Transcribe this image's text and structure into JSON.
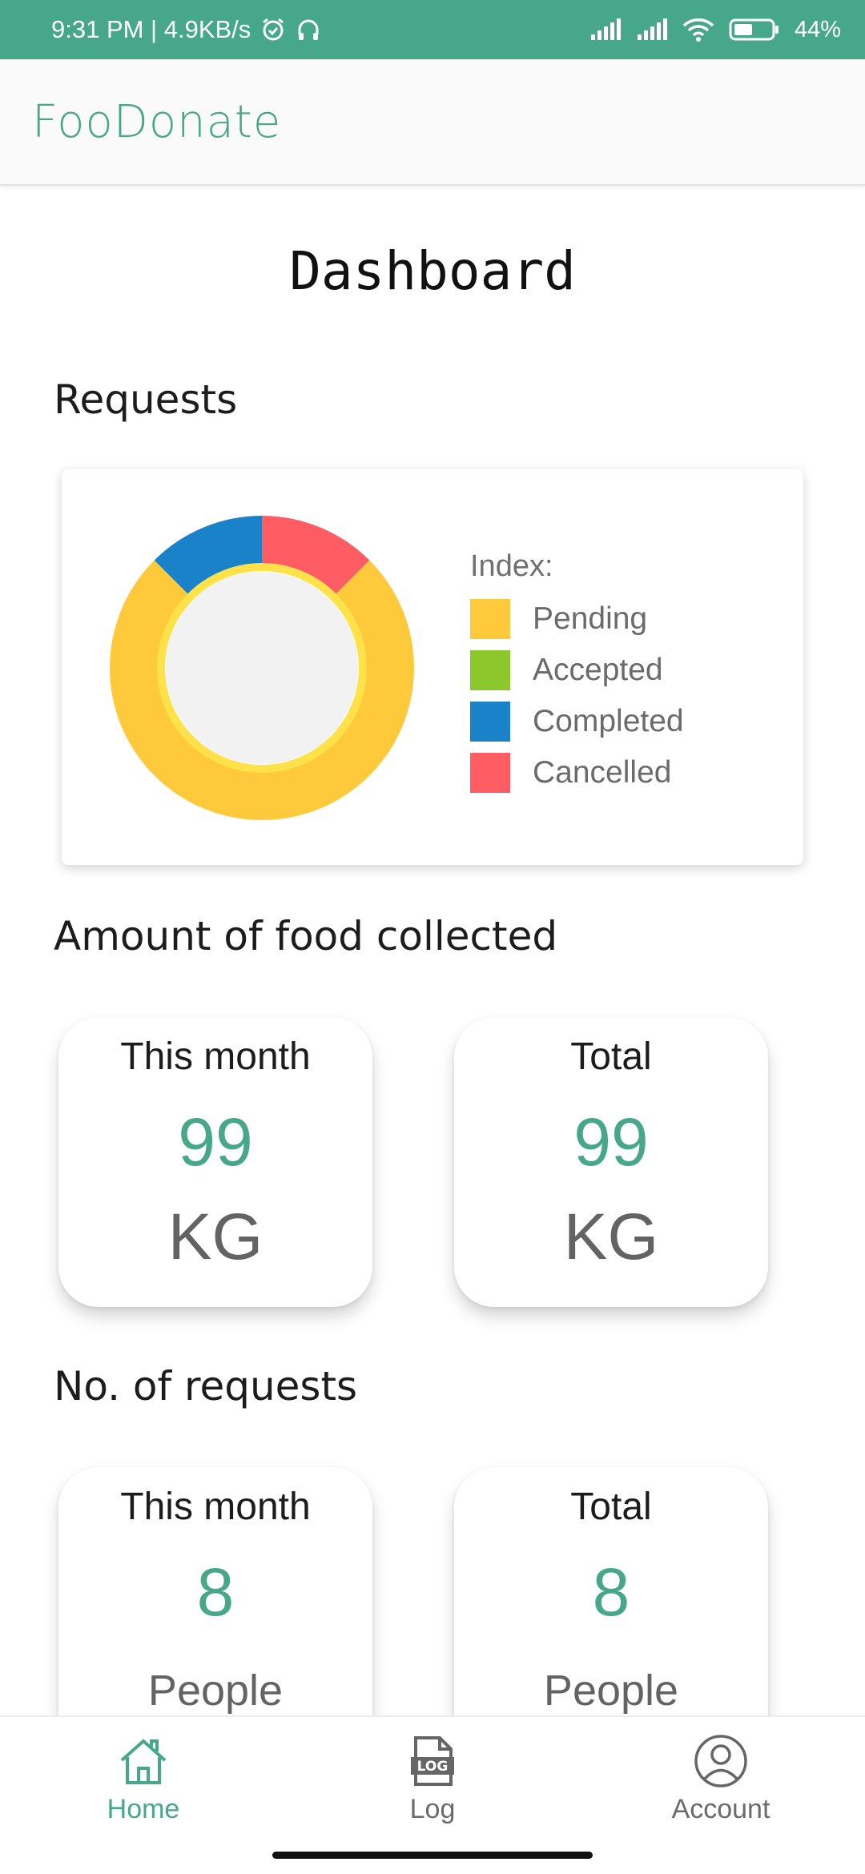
{
  "status_bar": {
    "time_speed": "9:31 PM | 4.9KB/s",
    "battery": "44%",
    "icons": [
      "alarm-icon",
      "headset-icon",
      "signal-icon",
      "signal-icon",
      "wifi-icon",
      "battery-icon"
    ]
  },
  "app_bar": {
    "title": "FooDonate"
  },
  "page": {
    "title": "Dashboard"
  },
  "sections": {
    "requests": "Requests",
    "food": "Amount of food collected",
    "num_requests": "No. of requests"
  },
  "chart_data": {
    "type": "pie",
    "donut": true,
    "legend_title": "Index:",
    "legend_position": "right",
    "series": [
      {
        "name": "Pending",
        "value": 0.75,
        "color": "#FFC93C"
      },
      {
        "name": "Accepted",
        "value": 0.0,
        "color": "#8CC82B"
      },
      {
        "name": "Completed",
        "value": 0.125,
        "color": "#1A82C8"
      },
      {
        "name": "Cancelled",
        "value": 0.125,
        "color": "#FF5C63"
      }
    ]
  },
  "food_stats": [
    {
      "label": "This month",
      "value": "99",
      "unit": "KG"
    },
    {
      "label": "Total",
      "value": "99",
      "unit": "KG"
    }
  ],
  "request_stats": [
    {
      "label": "This month",
      "value": "8",
      "unit": "People"
    },
    {
      "label": "Total",
      "value": "8",
      "unit": "People"
    }
  ],
  "bottom_nav": {
    "items": [
      {
        "label": "Home",
        "icon": "home-icon",
        "active": true
      },
      {
        "label": "Log",
        "icon": "log-icon",
        "active": false
      },
      {
        "label": "Account",
        "icon": "account-icon",
        "active": false
      }
    ]
  },
  "colors": {
    "accent": "#46A888",
    "pending": "#FFC93C",
    "accepted": "#8CC82B",
    "completed": "#1A82C8",
    "cancelled": "#FF5C63"
  }
}
